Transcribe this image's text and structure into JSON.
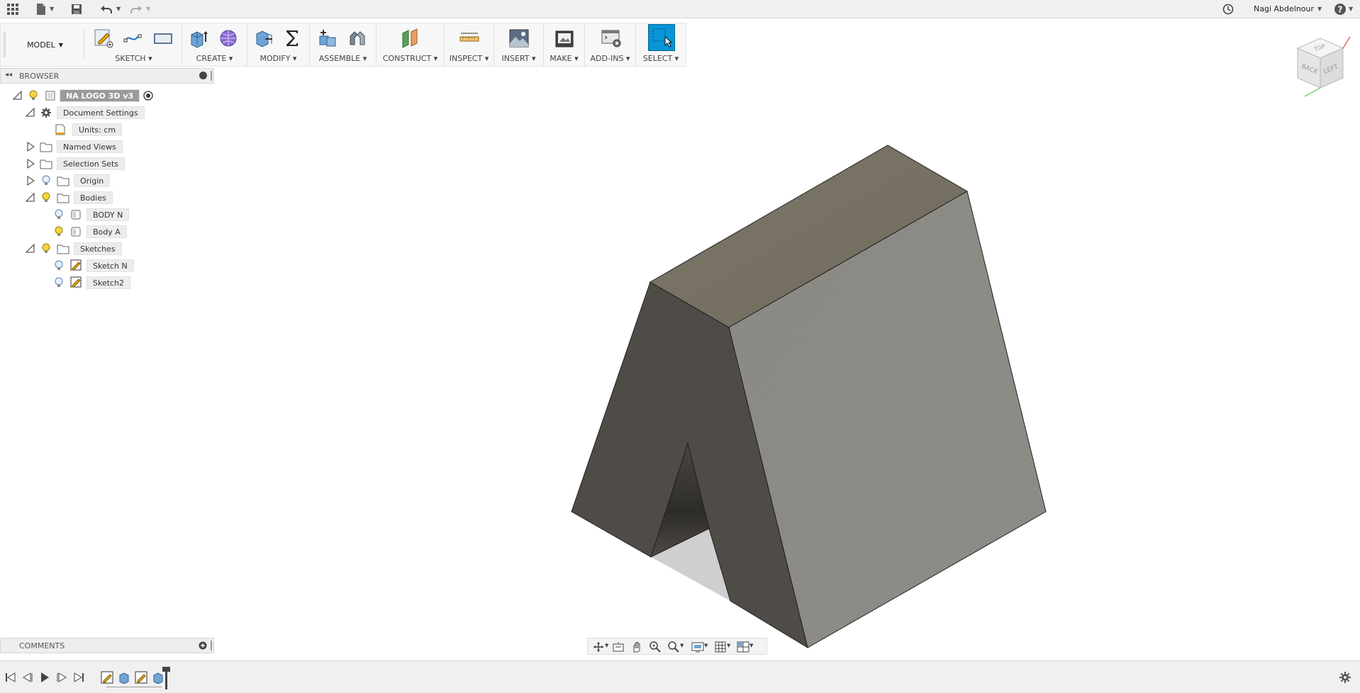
{
  "topbar": {
    "user_name": "Nagi Abdelnour",
    "help_label": "?"
  },
  "ribbon": {
    "workspace": "MODEL",
    "groups": [
      {
        "label": "SKETCH"
      },
      {
        "label": "CREATE"
      },
      {
        "label": "MODIFY"
      },
      {
        "label": "ASSEMBLE"
      },
      {
        "label": "CONSTRUCT"
      },
      {
        "label": "INSPECT"
      },
      {
        "label": "INSERT"
      },
      {
        "label": "MAKE"
      },
      {
        "label": "ADD-INS"
      },
      {
        "label": "SELECT"
      }
    ]
  },
  "browser": {
    "title": "BROWSER",
    "root": "NA LOGO 3D v3",
    "items": [
      {
        "label": "Document Settings"
      },
      {
        "label": "Units: cm"
      },
      {
        "label": "Named Views"
      },
      {
        "label": "Selection Sets"
      },
      {
        "label": "Origin"
      },
      {
        "label": "Bodies"
      },
      {
        "label": "BODY N"
      },
      {
        "label": "Body A"
      },
      {
        "label": "Sketches"
      },
      {
        "label": "Sketch N"
      },
      {
        "label": "Sketch2"
      }
    ]
  },
  "comments": {
    "title": "COMMENTS"
  },
  "viewcube": {
    "top": "TOP",
    "front": "BACK",
    "side": "LEFT"
  },
  "colors": {
    "accent": "#0696d7",
    "body_top": "#7a7466",
    "body_right": "#8a8a84",
    "body_left": "#504d47"
  }
}
